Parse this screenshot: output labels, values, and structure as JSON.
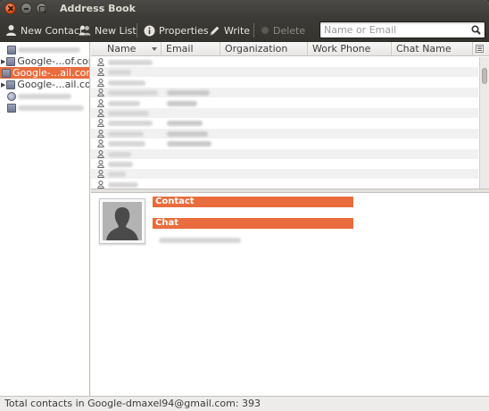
{
  "window": {
    "title": "Address Book"
  },
  "toolbar": {
    "new_contact": "New Contact",
    "new_list": "New List",
    "properties": "Properties",
    "write": "Write",
    "delete": "Delete"
  },
  "search": {
    "placeholder": "Name or Email",
    "value": ""
  },
  "directories": [
    {
      "label": "",
      "twisty": false,
      "selected": false,
      "icon": "book-icon"
    },
    {
      "label": "Google-...of.com",
      "twisty": true,
      "selected": false,
      "icon": "book-icon"
    },
    {
      "label": "Google-...ail.com",
      "twisty": false,
      "selected": true,
      "icon": "book-icon"
    },
    {
      "label": "Google-...ail.com",
      "twisty": true,
      "selected": false,
      "icon": "book-icon"
    },
    {
      "label": "",
      "twisty": false,
      "selected": false,
      "icon": "collected-addresses-icon"
    },
    {
      "label": "",
      "twisty": false,
      "selected": false,
      "icon": "book-icon"
    }
  ],
  "columns": [
    "Name",
    "Email",
    "Organization",
    "Work Phone",
    "Chat Name"
  ],
  "contacts_visible_rows": 13,
  "card": {
    "contact_header": "Contact",
    "chat_header": "Chat"
  },
  "status": {
    "text": "Total contacts in Google-dmaxel94@gmail.com: 393"
  },
  "colors": {
    "accent": "#e96c3c",
    "toolbar": "#3c3b37"
  }
}
